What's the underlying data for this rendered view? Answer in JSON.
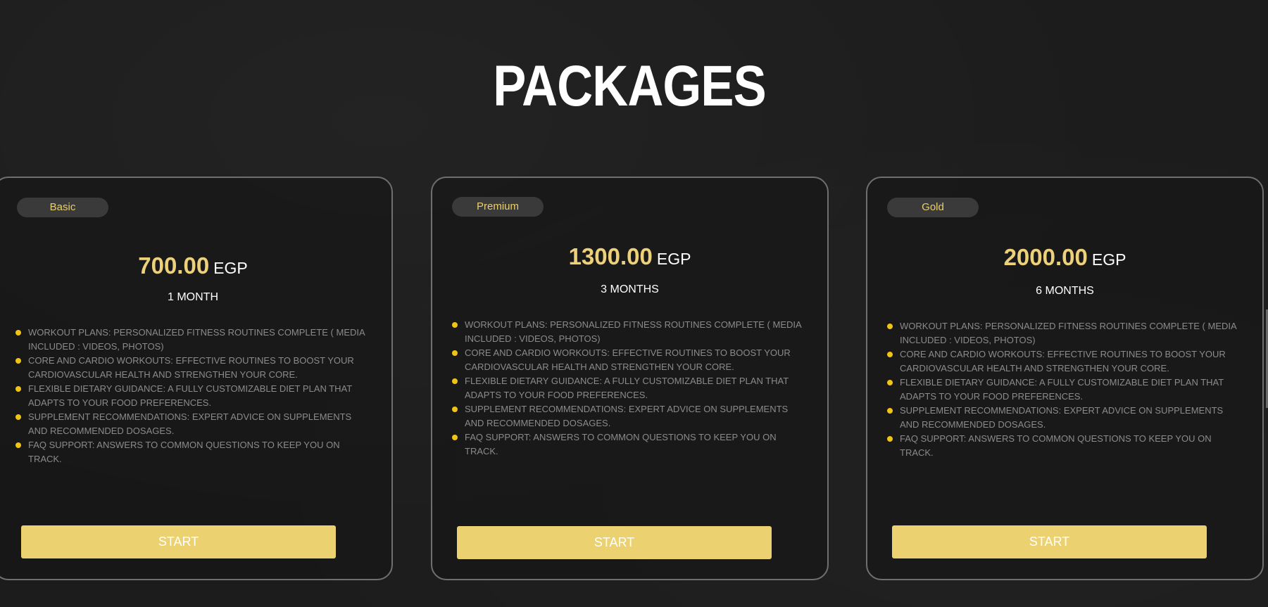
{
  "section": {
    "title": "PACKAGES"
  },
  "packages": [
    {
      "tier": "Basic",
      "amount": "700.00",
      "currency": "EGP",
      "duration": "1 MONTH",
      "features": [
        "WORKOUT PLANS: PERSONALIZED FITNESS ROUTINES COMPLETE ( MEDIA INCLUDED : VIDEOS, PHOTOS)",
        "CORE AND CARDIO WORKOUTS: EFFECTIVE ROUTINES TO BOOST YOUR CARDIOVASCULAR HEALTH AND STRENGTHEN YOUR CORE.",
        "FLEXIBLE DIETARY GUIDANCE: A FULLY CUSTOMIZABLE DIET PLAN THAT ADAPTS TO YOUR FOOD PREFERENCES.",
        "SUPPLEMENT RECOMMENDATIONS: EXPERT ADVICE ON SUPPLEMENTS AND RECOMMENDED DOSAGES.",
        "FAQ SUPPORT: ANSWERS TO COMMON QUESTIONS TO KEEP YOU ON TRACK."
      ],
      "button": "START"
    },
    {
      "tier": "Premium",
      "amount": "1300.00",
      "currency": "EGP",
      "duration": "3 MONTHS",
      "features": [
        "WORKOUT PLANS: PERSONALIZED FITNESS ROUTINES COMPLETE ( MEDIA INCLUDED : VIDEOS, PHOTOS)",
        "CORE AND CARDIO WORKOUTS: EFFECTIVE ROUTINES TO BOOST YOUR CARDIOVASCULAR HEALTH AND STRENGTHEN YOUR CORE.",
        "FLEXIBLE DIETARY GUIDANCE: A FULLY CUSTOMIZABLE DIET PLAN THAT ADAPTS TO YOUR FOOD PREFERENCES.",
        "SUPPLEMENT RECOMMENDATIONS: EXPERT ADVICE ON SUPPLEMENTS AND RECOMMENDED DOSAGES.",
        "FAQ SUPPORT: ANSWERS TO COMMON QUESTIONS TO KEEP YOU ON TRACK."
      ],
      "button": "START"
    },
    {
      "tier": "Gold",
      "amount": "2000.00",
      "currency": "EGP",
      "duration": "6 MONTHS",
      "features": [
        "WORKOUT PLANS: PERSONALIZED FITNESS ROUTINES COMPLETE ( MEDIA INCLUDED : VIDEOS, PHOTOS)",
        "CORE AND CARDIO WORKOUTS: EFFECTIVE ROUTINES TO BOOST YOUR CARDIOVASCULAR HEALTH AND STRENGTHEN YOUR CORE.",
        "FLEXIBLE DIETARY GUIDANCE: A FULLY CUSTOMIZABLE DIET PLAN THAT ADAPTS TO YOUR FOOD PREFERENCES.",
        "SUPPLEMENT RECOMMENDATIONS: EXPERT ADVICE ON SUPPLEMENTS AND RECOMMENDED DOSAGES.",
        "FAQ SUPPORT: ANSWERS TO COMMON QUESTIONS TO KEEP YOU ON TRACK."
      ],
      "button": "START"
    }
  ],
  "colors": {
    "accent": "#ecd170",
    "price": "#ecd07a",
    "bullet": "#f0c414",
    "background": "#1c1c1c",
    "card_border": "#6f6f6f"
  }
}
